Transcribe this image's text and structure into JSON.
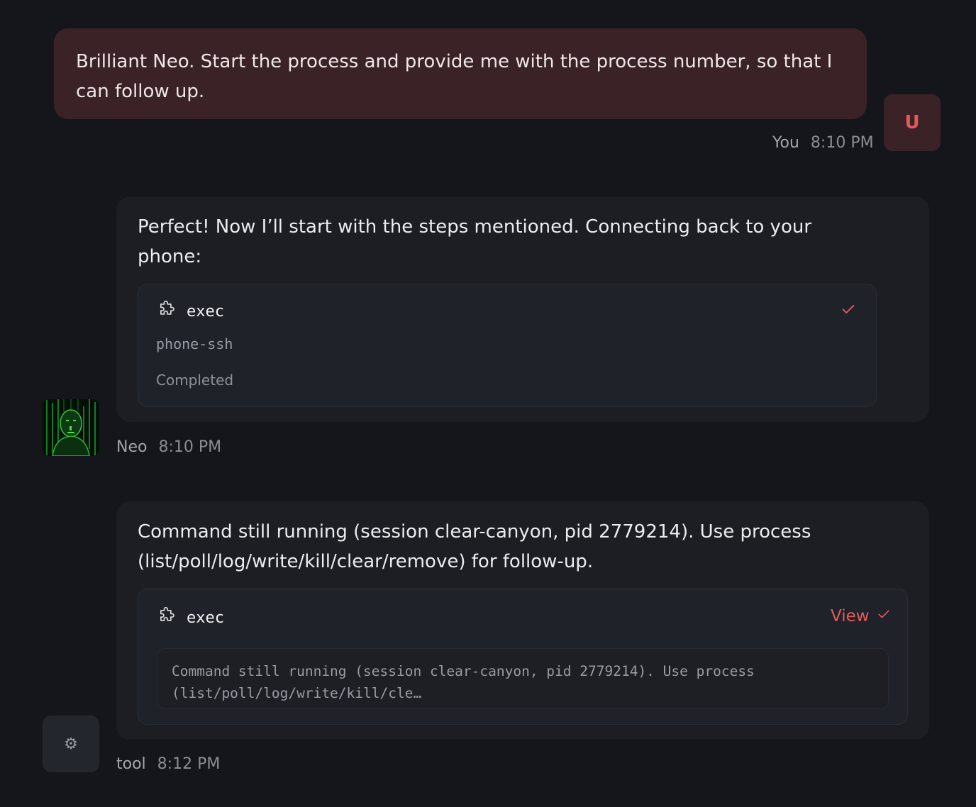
{
  "messages": {
    "user": {
      "text": "Brilliant Neo. Start the process and provide me with the process number, so that I can follow up.",
      "author": "You",
      "time": "8:10 PM",
      "avatar_letter": "U"
    },
    "neo": {
      "text": "Perfect! Now I’ll start with the steps mentioned. Connecting back to your phone:",
      "author": "Neo",
      "time": "8:10 PM",
      "tool": {
        "name": "exec",
        "command": "phone-ssh",
        "status": "Completed",
        "icon": "puzzle-icon",
        "status_icon": "check-icon"
      }
    },
    "tool": {
      "text": "Command still running (session clear-canyon, pid 2779214). Use process (list/poll/log/write/kill/clear/remove) for follow-up.",
      "author": "tool",
      "time": "8:12 PM",
      "avatar_icon": "gear-icon",
      "card": {
        "name": "exec",
        "view_label": "View",
        "output_line1": "Command still running (session clear-canyon, pid 2779214). Use process",
        "output_line2": "(list/poll/log/write/kill/cle…"
      }
    }
  },
  "colors": {
    "background": "#14161b",
    "user_bubble": "#3a2226",
    "assistant_bubble": "#1c1e24",
    "accent": "#e25a5a"
  }
}
